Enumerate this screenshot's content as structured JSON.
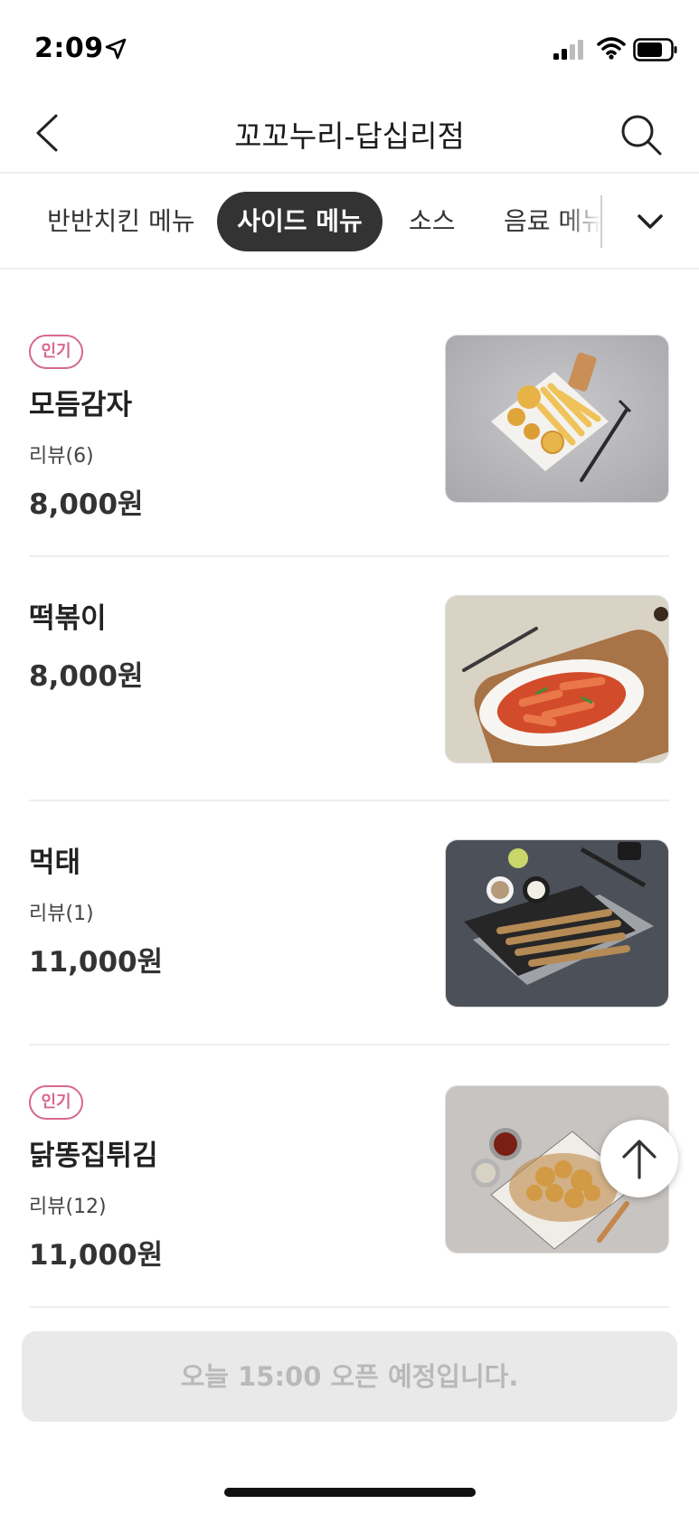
{
  "status_bar": {
    "time": "2:09"
  },
  "header": {
    "title": "꼬꼬누리-답십리점"
  },
  "tabs": [
    {
      "label": "반반치킨 메뉴",
      "active": false
    },
    {
      "label": "사이드 메뉴",
      "active": true
    },
    {
      "label": "소스",
      "active": false
    },
    {
      "label": "음료 메뉴",
      "active": false
    }
  ],
  "menu": [
    {
      "badge": "인기",
      "name": "모듬감자",
      "review": "리뷰(6)",
      "price": "8,000원",
      "image": "fries-plate-photo"
    },
    {
      "badge": "",
      "name": "떡볶이",
      "review": "",
      "price": "8,000원",
      "image": "tteokbokki-photo"
    },
    {
      "badge": "",
      "name": "먹태",
      "review": "리뷰(1)",
      "price": "11,000원",
      "image": "dried-pollock-photo"
    },
    {
      "badge": "인기",
      "name": "닭똥집튀김",
      "review": "리뷰(12)",
      "price": "11,000원",
      "image": "fried-gizzard-photo"
    }
  ],
  "order_bar": {
    "label": "오늘 15:00 오픈 예정입니다."
  },
  "colors": {
    "accent_pink": "#d8678f",
    "active_tab": "#333333",
    "disabled_bar": "#e9e9e9"
  }
}
